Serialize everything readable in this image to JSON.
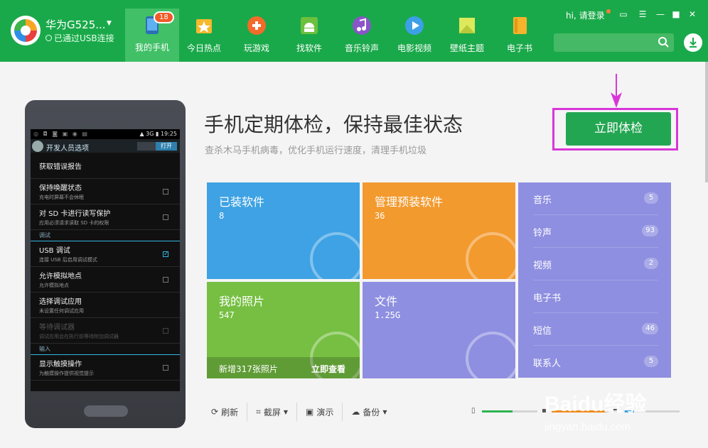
{
  "header": {
    "device_name": "华为G525...",
    "usb_status": "已通过USB连接",
    "greeting": "hi, 请登录",
    "nav": [
      {
        "label": "我的手机",
        "badge": "18"
      },
      {
        "label": "今日热点"
      },
      {
        "label": "玩游戏"
      },
      {
        "label": "找软件"
      },
      {
        "label": "音乐铃声"
      },
      {
        "label": "电影视频"
      },
      {
        "label": "壁纸主题"
      },
      {
        "label": "电子书"
      }
    ]
  },
  "phone": {
    "time": "19:25",
    "network": "3G",
    "title": "开发人员选项",
    "toggle": "打开",
    "rows": [
      {
        "title": "获取错误报告",
        "sub": ""
      },
      {
        "title": "保持唤醒状态",
        "sub": "充电时屏幕不会休眠"
      },
      {
        "title": "对 SD 卡进行读写保护",
        "sub": "应用必须请求读取 SD 卡的权限"
      }
    ],
    "section_debug": "调试",
    "rows_debug": [
      {
        "title": "USB 调试",
        "sub": "连接 USB 后启用调试模式"
      },
      {
        "title": "允许模拟地点",
        "sub": "允许模拟地点"
      },
      {
        "title": "选择调试应用",
        "sub": "未设置任何调试应用"
      },
      {
        "title": "等待调试器",
        "sub": "调试应用会在执行前等待附加调试器"
      }
    ],
    "section_input": "输入",
    "rows_input": [
      {
        "title": "显示触摸操作",
        "sub": "为触摸操作提供视觉提示"
      }
    ]
  },
  "main": {
    "headline": "手机定期体检，保持最佳状态",
    "subline": "查杀木马手机病毒，优化手机运行速度，清理手机垃圾",
    "check_button": "立即体检",
    "tiles": {
      "installed": {
        "title": "已装软件",
        "value": "8",
        "color": "#3ea2e4"
      },
      "preinstalled": {
        "title": "管理预装软件",
        "value": "36",
        "color": "#f39a2e"
      },
      "photos": {
        "title": "我的照片",
        "value": "547",
        "footer": "新增317张照片",
        "footer_action": "立即查看",
        "color": "#76bf42"
      },
      "files": {
        "title": "文件",
        "value": "1.25G",
        "color": "#8e8fe0"
      }
    },
    "media": [
      {
        "label": "音乐",
        "count": "5"
      },
      {
        "label": "铃声",
        "count": "93"
      },
      {
        "label": "视频",
        "count": "2"
      },
      {
        "label": "电子书",
        "count": ""
      },
      {
        "label": "短信",
        "count": "46"
      },
      {
        "label": "联系人",
        "count": "5"
      }
    ],
    "toolbar": {
      "refresh": "刷新",
      "screenshot": "截屏",
      "demo": "演示",
      "backup": "备份"
    },
    "storage": [
      {
        "name": "phone",
        "used": 0.55,
        "color": "#2fb34f"
      },
      {
        "name": "sd1",
        "used": 0.95,
        "color": "#f08a1c"
      },
      {
        "name": "sd2",
        "used": 0.2,
        "color": "#3ea2e4"
      }
    ],
    "watermark": {
      "brand": "Baidu经验",
      "url": "jingyan.baidu.com"
    }
  }
}
